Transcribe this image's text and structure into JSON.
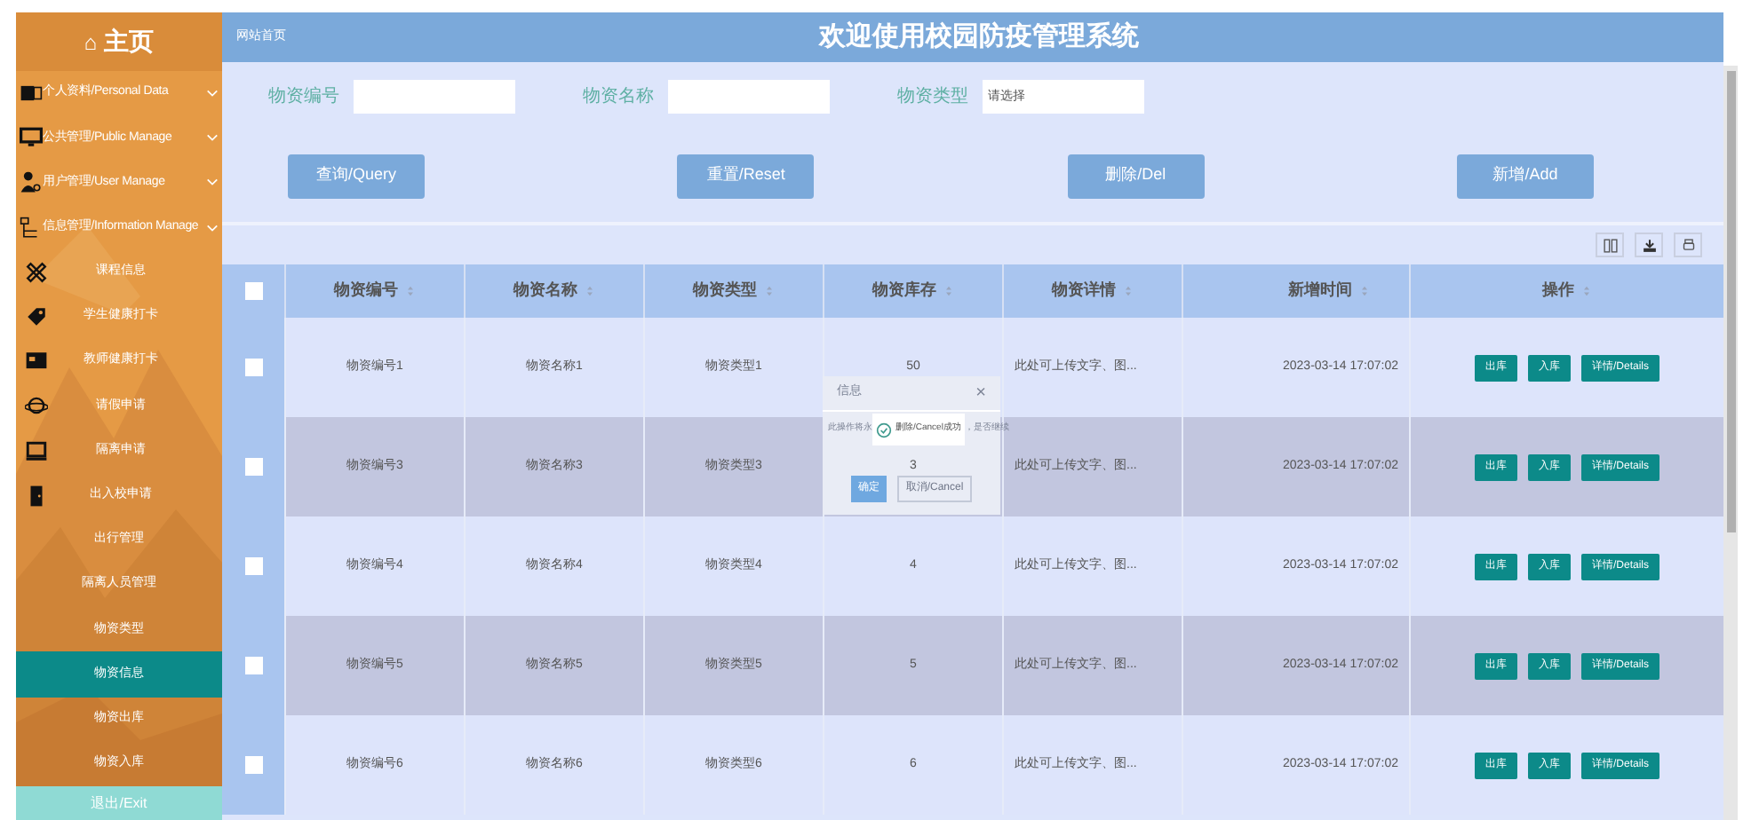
{
  "sidebar": {
    "home": {
      "icon": "⌂",
      "label": "主页"
    },
    "items": [
      {
        "label": "个人资料/Personal Data",
        "kind": "group",
        "selected": false
      },
      {
        "label": "公共管理/Public Manage",
        "kind": "group",
        "selected": false
      },
      {
        "label": "用户管理/User Manage",
        "kind": "group",
        "selected": false
      },
      {
        "label": "信息管理/Information Manage",
        "kind": "group",
        "selected": false
      },
      {
        "label": "课程信息",
        "kind": "icon",
        "selected": false
      },
      {
        "label": "学生健康打卡",
        "kind": "icon",
        "selected": false
      },
      {
        "label": "教师健康打卡",
        "kind": "icon",
        "selected": false
      },
      {
        "label": "请假申请",
        "kind": "icon",
        "selected": false
      },
      {
        "label": "隔离申请",
        "kind": "icon",
        "selected": false
      },
      {
        "label": "出入校申请",
        "kind": "icon",
        "selected": false
      },
      {
        "label": "出行管理",
        "kind": "plain",
        "selected": false
      },
      {
        "label": "隔离人员管理",
        "kind": "plain",
        "selected": false
      },
      {
        "label": "物资类型",
        "kind": "plain",
        "selected": false
      },
      {
        "label": "物资信息",
        "kind": "plain",
        "selected": true
      },
      {
        "label": "物资出库",
        "kind": "plain",
        "selected": false
      },
      {
        "label": "物资入库",
        "kind": "plain",
        "selected": false
      }
    ],
    "exit": "退出/Exit"
  },
  "header": {
    "home_link": "网站首页",
    "title": "欢迎使用校园防疫管理系统"
  },
  "search": {
    "fields": [
      {
        "label": "物资编号",
        "kind": "input"
      },
      {
        "label": "物资名称",
        "kind": "input"
      },
      {
        "label": "物资类型",
        "kind": "select",
        "placeholder": "请选择"
      }
    ],
    "buttons": [
      "查询/Query",
      "重置/Reset",
      "删除/Del",
      "新增/Add"
    ]
  },
  "table": {
    "select_all_checked": false,
    "columns": [
      "物资编号",
      "物资名称",
      "物资类型",
      "物资库存",
      "物资详情",
      "新增时间",
      "操作"
    ],
    "rows": [
      {
        "code": "物资编号1",
        "name": "物资名称1",
        "type": "物资类型1",
        "stock": "50",
        "details": "此处可上传文字、图...",
        "time": "2023-03-14 17:07:02",
        "checked": false,
        "actions": [
          "出库",
          "入库",
          "详情/Details"
        ]
      },
      {
        "code": "物资编号3",
        "name": "物资名称3",
        "type": "物资类型3",
        "stock": "3",
        "details": "此处可上传文字、图...",
        "time": "2023-03-14 17:07:02",
        "checked": false,
        "actions": [
          "出库",
          "入库",
          "详情/Details"
        ]
      },
      {
        "code": "物资编号4",
        "name": "物资名称4",
        "type": "物资类型4",
        "stock": "4",
        "details": "此处可上传文字、图...",
        "time": "2023-03-14 17:07:02",
        "checked": false,
        "actions": [
          "出库",
          "入库",
          "详情/Details"
        ]
      },
      {
        "code": "物资编号5",
        "name": "物资名称5",
        "type": "物资类型5",
        "stock": "5",
        "details": "此处可上传文字、图...",
        "time": "2023-03-14 17:07:02",
        "checked": false,
        "actions": [
          "出库",
          "入库",
          "详情/Details"
        ]
      },
      {
        "code": "物资编号6",
        "name": "物资名称6",
        "type": "物资类型6",
        "stock": "6",
        "details": "此处可上传文字、图...",
        "time": "2023-03-14 17:07:02",
        "checked": false,
        "actions": [
          "出库",
          "入库",
          "详情/Details"
        ]
      }
    ]
  },
  "dialog": {
    "title": "信息",
    "close": "×",
    "message_start": "此操作将永",
    "message_end": "，是否继续",
    "buttons": [
      "确定",
      "取消/Cancel"
    ]
  },
  "toast": {
    "text": "删除/Cancel成功"
  }
}
